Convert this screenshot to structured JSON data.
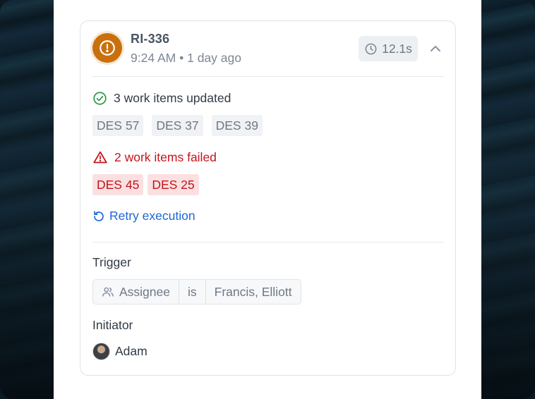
{
  "run": {
    "id": "RI-336",
    "time": "9:24 AM",
    "ago": "1 day ago",
    "duration": "12.1s",
    "status_color": "#c9700d"
  },
  "updated": {
    "label": "3 work items updated",
    "items": [
      "DES 57",
      "DES 37",
      "DES 39"
    ],
    "color": "#2f9a48"
  },
  "failed": {
    "label": "2 work items failed",
    "items": [
      "DES 45",
      "DES 25"
    ],
    "color": "#c4141c"
  },
  "retry_label": "Retry execution",
  "trigger": {
    "label": "Trigger",
    "field": "Assignee",
    "operator": "is",
    "value": "Francis, Elliott"
  },
  "initiator": {
    "label": "Initiator",
    "name": "Adam"
  },
  "icons": {
    "status": "alert-circle-icon",
    "duration": "clock-icon",
    "collapse": "chevron-up-icon",
    "updated": "check-circle-icon",
    "failed": "warning-triangle-icon",
    "retry": "rotate-ccw-icon",
    "field": "users-icon"
  }
}
